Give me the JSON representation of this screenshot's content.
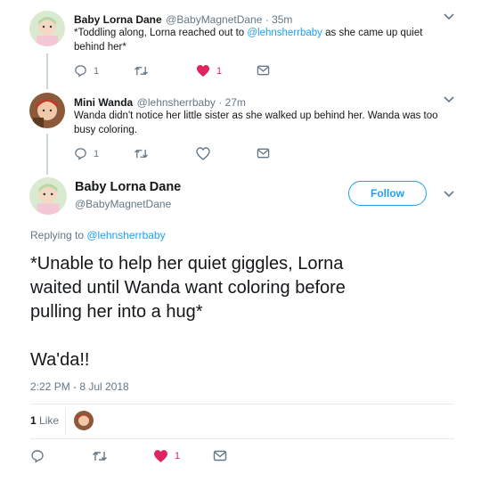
{
  "reply1": {
    "display_name": "Baby Lorna Dane",
    "handle_time": "@BabyMagnetDane · 35m",
    "text_before": "*Toddling along, Lorna reached out to ",
    "mention": "@lehnsherrbaby",
    "text_after": " as she came up quiet behind her*",
    "reply_count": "1",
    "like_count": "1",
    "liked": true
  },
  "reply2": {
    "display_name": "Mini Wanda",
    "handle_time": "@lehnsherrbaby · 27m",
    "text": "Wanda didn't notice her little sister as she walked up behind her. Wanda was too busy coloring.",
    "reply_count": "1"
  },
  "main_tweet": {
    "display_name": "Baby Lorna Dane",
    "handle": "@BabyMagnetDane",
    "follow_label": "Follow",
    "replying_prefix": "Replying to ",
    "replying_to": "@lehnsherrbaby",
    "text_line1": "*Unable to help her quiet giggles, Lorna",
    "text_line2": "waited until Wanda want coloring before",
    "text_line3": "pulling her into a hug*",
    "text_line4": "Wa'da!!",
    "timestamp": "2:22 PM - 8 Jul 2018",
    "likes_number": "1",
    "likes_label": "Like",
    "like_count": "1"
  },
  "colors": {
    "accent": "#1da1f2",
    "like": "#e0245e",
    "muted": "#657786",
    "text": "#14171a",
    "divider": "#e6ecf0"
  },
  "icons": [
    "reply-icon",
    "retweet-icon",
    "heart-icon",
    "message-icon",
    "chevron-down-icon"
  ]
}
